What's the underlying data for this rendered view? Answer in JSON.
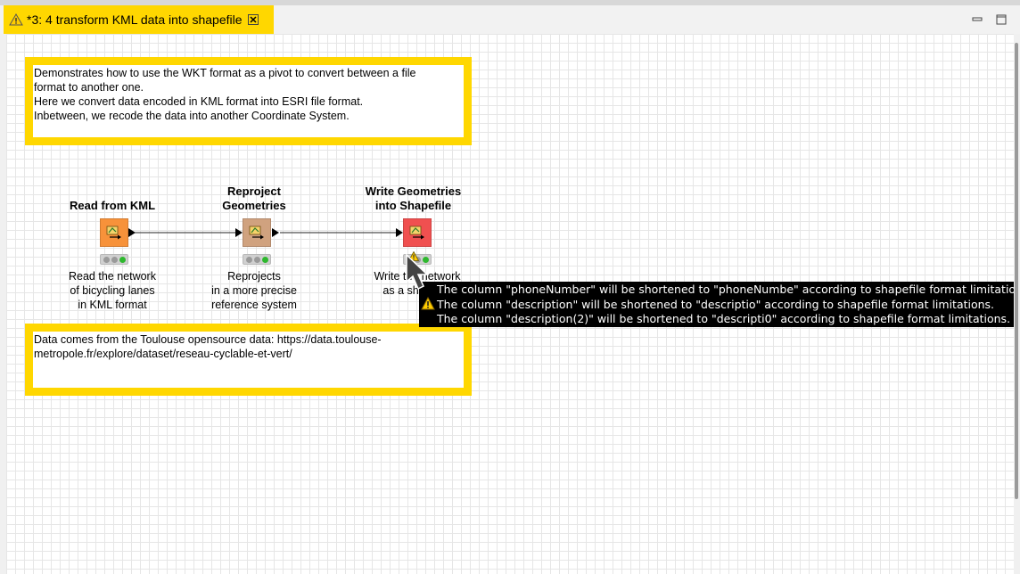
{
  "tab": {
    "title": "*3: 4 transform KML data into shapefile"
  },
  "annotations": {
    "top": [
      "Demonstrates how to use the WKT format as a pivot to convert between a file",
      "format to another one.",
      "Here we convert data encoded in KML format into ESRI file format.",
      "Inbetween, we recode the data into another Coordinate System."
    ],
    "bottom": [
      "Data comes from the Toulouse opensource data: https://data.toulouse-",
      "metropole.fr/explore/dataset/reseau-cyclable-et-vert/"
    ]
  },
  "nodes": [
    {
      "title": [
        "Read from KML"
      ],
      "desc": [
        "Read the network",
        "of bicycling lanes",
        "in KML format"
      ],
      "color": "#f7923a"
    },
    {
      "title": [
        "Reproject",
        "Geometries"
      ],
      "desc": [
        "Reprojects",
        "in a more precise",
        "reference system"
      ],
      "color": "#d0a27f"
    },
    {
      "title": [
        "Write Geometries",
        "into Shapefile"
      ],
      "desc": [
        "Write the network",
        "as a shapefile"
      ],
      "color": "#f05050"
    }
  ],
  "tooltip": [
    "The column \"phoneNumber\" will be shortened to \"phoneNumbe\" according to shapefile format limitations.",
    "The column \"description\" will be shortened to \"descriptio\" according to shapefile format limitations.",
    "The column \"description(2)\" will be shortened to \"descripti0\" according to shapefile format limitations."
  ],
  "colors": {
    "accent": "#ffd700",
    "node_read": "#f7923a",
    "node_reproject": "#d0a27f",
    "node_write": "#f05050"
  }
}
